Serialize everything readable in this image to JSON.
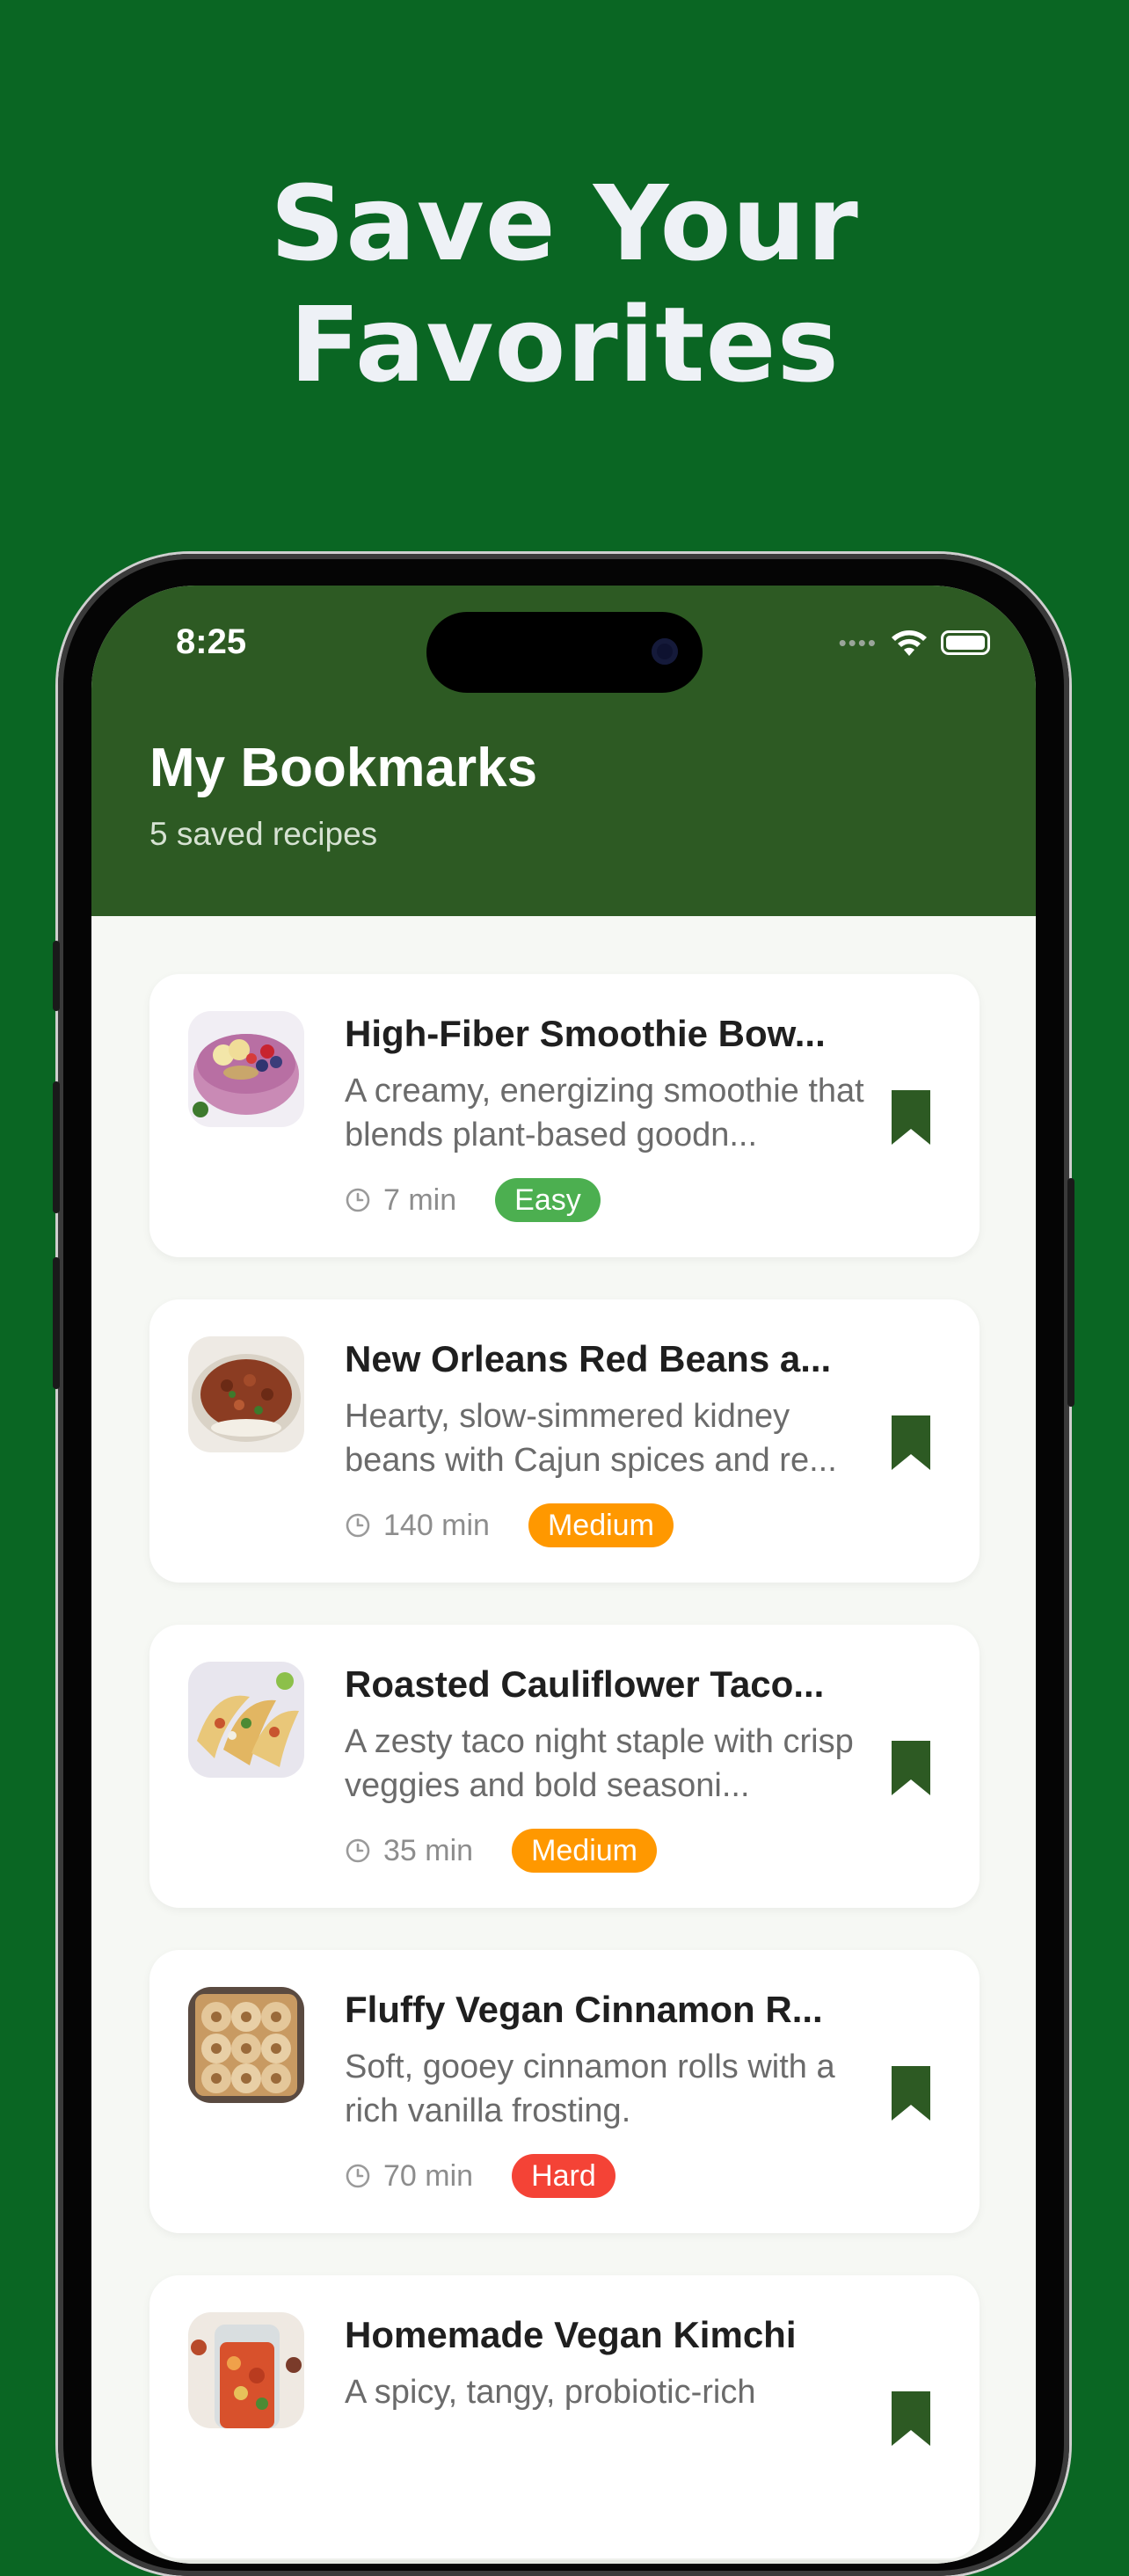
{
  "headline": "Save Your Favorites",
  "status_bar": {
    "time": "8:25",
    "signal_icon": "signal-dots-icon",
    "wifi_icon": "wifi-icon",
    "battery_icon": "battery-icon"
  },
  "screen": {
    "title": "My Bookmarks",
    "subtitle": "5 saved recipes"
  },
  "recipes": [
    {
      "title": "High-Fiber Smoothie Bow...",
      "desc": "A creamy, energizing smoothie that blends plant-based goodn...",
      "time": "7 min",
      "difficulty": "Easy",
      "badge_color": "#4caf50"
    },
    {
      "title": "New Orleans Red Beans a...",
      "desc": "Hearty, slow-simmered kidney beans with Cajun spices and re...",
      "time": "140 min",
      "difficulty": "Medium",
      "badge_color": "#ff9800"
    },
    {
      "title": "Roasted Cauliflower Taco...",
      "desc": "A zesty taco night staple with crisp veggies and bold seasoni...",
      "time": "35 min",
      "difficulty": "Medium",
      "badge_color": "#ff9800"
    },
    {
      "title": "Fluffy Vegan Cinnamon R...",
      "desc": "Soft, gooey cinnamon rolls with a rich vanilla frosting.",
      "time": "70 min",
      "difficulty": "Hard",
      "badge_color": "#f44336"
    },
    {
      "title": "Homemade Vegan Kimchi",
      "desc": "A spicy, tangy, probiotic-rich",
      "time": "",
      "difficulty": "",
      "badge_color": ""
    }
  ],
  "colors": {
    "background": "#0a6623",
    "header": "#2d5a23",
    "bookmark": "#2d5a23"
  }
}
